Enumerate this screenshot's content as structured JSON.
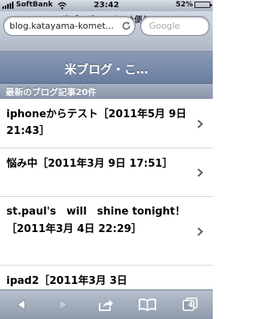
{
  "status_bar": {
    "carrier": "SoftBank",
    "time": "23:42",
    "battery_text": "52%",
    "battery_level": 0.52,
    "icons": [
      "signal-icon",
      "wifi-icon",
      "battery-icon"
    ]
  },
  "browser": {
    "page_title": "米ブログ・こめこめ便り",
    "url": "blog.katayama-komet...",
    "search_placeholder": "Google"
  },
  "blog": {
    "title": "米ブログ・こ…"
  },
  "section": {
    "header": "最新のブログ記事20件"
  },
  "posts": [
    {
      "title": "iphoneからテスト［2011年5月 9日 21:43］"
    },
    {
      "title": "悩み中［2011年3月 9日 17:51］"
    },
    {
      "title": "st.paul's　will　shine tonight！［2011年3月 4日 22:29］"
    },
    {
      "title": "ipad2［2011年3月 3日"
    }
  ],
  "toolbar": {
    "tabs_count": "4",
    "icons": [
      "back-icon",
      "forward-icon",
      "share-icon",
      "bookmarks-icon",
      "tabs-icon"
    ]
  }
}
